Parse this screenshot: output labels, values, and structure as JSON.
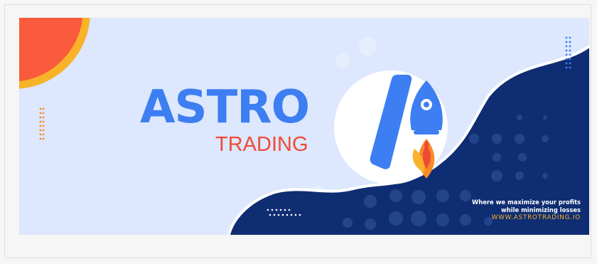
{
  "banner": {
    "title": "ASTRO",
    "subtitle": "TRADING",
    "tagline_line1": "Where we maximize your profits",
    "tagline_line2": "while minimizing losses",
    "website": "WWW.ASTROTRADING.IO"
  },
  "colors": {
    "background": "#dde7fd",
    "navy": "#0f2d72",
    "blue": "#3d7ef2",
    "orange": "#f58c28",
    "red": "#ee4b36",
    "sun": "#f95b3c",
    "sun_ring": "#f8b329",
    "white": "#ffffff"
  },
  "icons": {
    "logo": "rocket-logo-icon",
    "sun": "sun-shape-icon"
  }
}
